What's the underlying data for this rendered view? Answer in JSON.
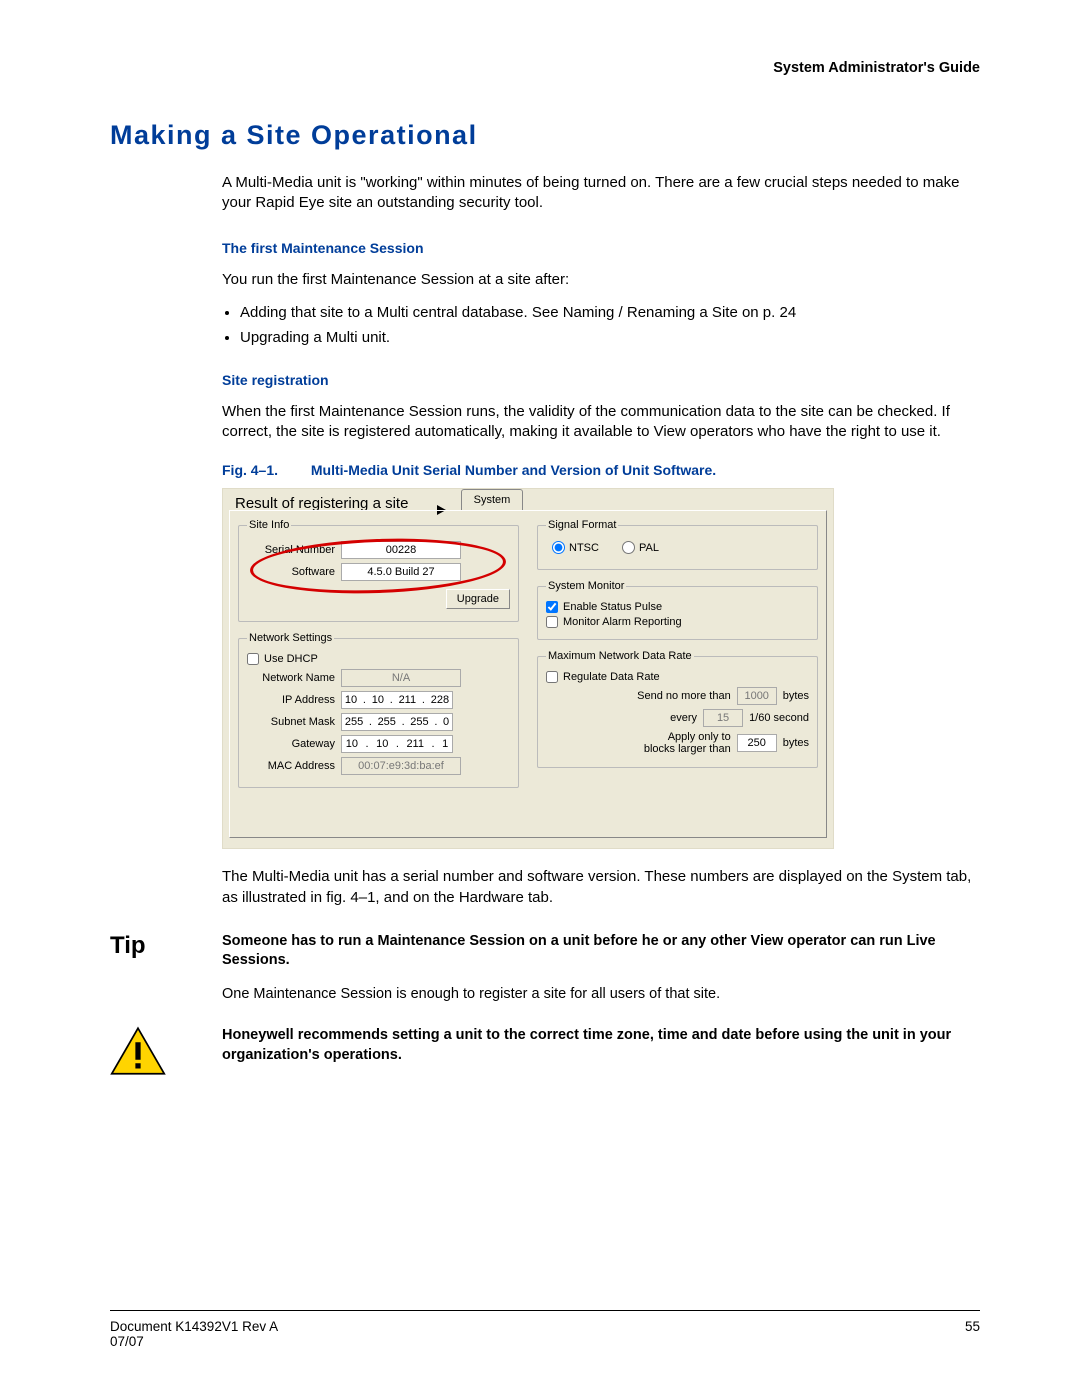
{
  "header": {
    "guide": "System Administrator's Guide"
  },
  "title": "Making a Site Operational",
  "intro": "A Multi-Media unit is \"working\" within minutes of being turned on. There are a few crucial steps needed to make your Rapid Eye site an outstanding security tool.",
  "sect1": {
    "head": "The first Maintenance Session",
    "lead": "You run the first Maintenance Session at a site after:",
    "bullets": [
      "Adding that site to a Multi central database. See Naming / Renaming a Site on p. 24",
      "Upgrading a Multi unit."
    ]
  },
  "sect2": {
    "head": "Site registration",
    "body": "When the first Maintenance Session runs, the validity of the communication data to the site can be checked. If correct, the site is registered automatically, making it available to View operators who have the right to use it."
  },
  "figure": {
    "num": "Fig. 4–1.",
    "title": "Multi-Media Unit Serial Number and Version of Unit Software."
  },
  "dialog": {
    "annot": "Result of registering a site",
    "tab": "System",
    "site_info": {
      "legend": "Site Info",
      "serial_label": "Serial Number",
      "serial_value": "00228",
      "software_label": "Software",
      "software_value": "4.5.0 Build 27",
      "upgrade_btn": "Upgrade"
    },
    "network": {
      "legend": "Network Settings",
      "use_dhcp": "Use DHCP",
      "name_label": "Network Name",
      "name_value": "N/A",
      "ip_label": "IP Address",
      "ip": [
        "10",
        "10",
        "211",
        "228"
      ],
      "subnet_label": "Subnet Mask",
      "subnet": [
        "255",
        "255",
        "255",
        "0"
      ],
      "gateway_label": "Gateway",
      "gateway": [
        "10",
        "10",
        "211",
        "1"
      ],
      "mac_label": "MAC Address",
      "mac_value": "00:07:e9:3d:ba:ef"
    },
    "signal": {
      "legend": "Signal Format",
      "ntsc": "NTSC",
      "pal": "PAL"
    },
    "monitor": {
      "legend": "System Monitor",
      "enable_pulse": "Enable Status Pulse",
      "alarm": "Monitor Alarm Reporting"
    },
    "rate": {
      "legend": "Maximum Network Data Rate",
      "regulate": "Regulate Data Rate",
      "send_label": "Send no more than",
      "send_value": "1000",
      "bytes": "bytes",
      "every_label": "every",
      "every_value": "15",
      "every_unit": "1/60 second",
      "apply_label": "Apply only to\nblocks larger than",
      "apply_value": "250",
      "apply_unit": "bytes"
    }
  },
  "after_fig": "The Multi-Media unit has a serial number and software version. These numbers are displayed on the System tab, as illustrated in fig. 4–1, and on the Hardware tab.",
  "tip": {
    "label": "Tip",
    "bold": "Someone has to run a Maintenance Session on a unit before he or any other View operator can run Live Sessions.",
    "normal": "One Maintenance Session is enough to register a site for all users of that site."
  },
  "warn": "Honeywell recommends setting a unit to the correct time zone, time and date before using the unit in your organization's operations.",
  "footer": {
    "doc": "Document K14392V1 Rev A",
    "date": "07/07",
    "page": "55"
  }
}
